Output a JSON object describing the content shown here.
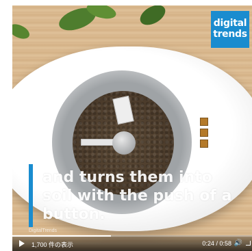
{
  "logo": {
    "line1": "digital",
    "line2": "trends"
  },
  "caption": {
    "text": "and turns them into soil with the push of a button."
  },
  "watermark": "DigitalTrends",
  "player": {
    "views": "1,700 件の表示",
    "current_time": "0:24",
    "duration": "0:58",
    "progress": 0.41
  },
  "colors": {
    "accent": "#1a8ccf",
    "soil": "#4a3a2a"
  },
  "icons": {
    "play": "play-icon",
    "volume": "volume-icon",
    "fullscreen": "fullscreen-icon"
  }
}
